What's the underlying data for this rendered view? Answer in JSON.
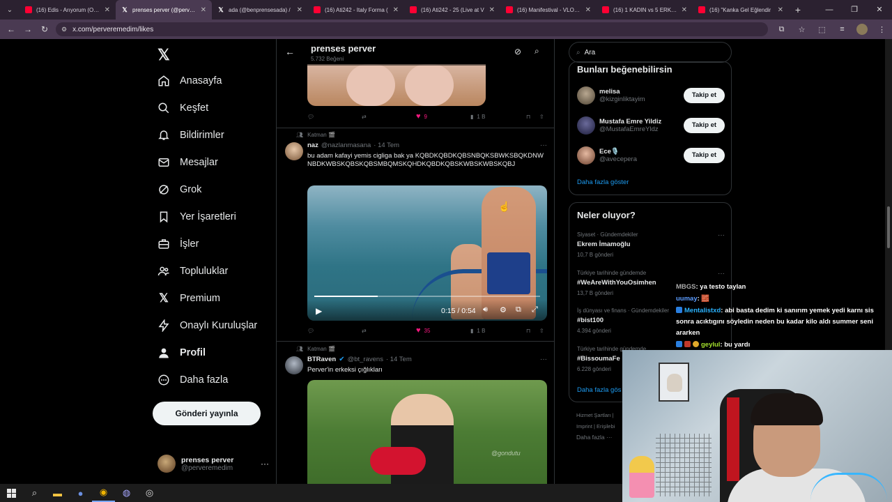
{
  "browser": {
    "tabs": [
      {
        "title": "(16) Edis - Arıyorum (Offic",
        "favicon": "yt",
        "active": false
      },
      {
        "title": "prenses perver (@pervere",
        "favicon": "x",
        "active": true
      },
      {
        "title": "ada (@benprensesada) / ",
        "favicon": "x",
        "active": false
      },
      {
        "title": "(16) Ati242 - Italy Forma (",
        "favicon": "yt",
        "active": false
      },
      {
        "title": "(16) Ati242 - 25 (Live at V",
        "favicon": "yt",
        "active": false
      },
      {
        "title": "(16) Manifestival - VLOG |",
        "favicon": "yt",
        "active": false
      },
      {
        "title": "(16) 1 KADIN vs 5 ERKEK |",
        "favicon": "yt",
        "active": false
      },
      {
        "title": "(16) \"Kanka Gel Eğlendir",
        "favicon": "yt",
        "active": false
      }
    ],
    "url": "x.com/perveremedim/likes"
  },
  "nav": {
    "items": [
      {
        "label": "Anasayfa",
        "icon": "home-icon"
      },
      {
        "label": "Keşfet",
        "icon": "search-icon"
      },
      {
        "label": "Bildirimler",
        "icon": "bell-icon"
      },
      {
        "label": "Mesajlar",
        "icon": "mail-icon"
      },
      {
        "label": "Grok",
        "icon": "grok-icon"
      },
      {
        "label": "Yer İşaretleri",
        "icon": "bookmark-icon"
      },
      {
        "label": "İşler",
        "icon": "briefcase-icon"
      },
      {
        "label": "Topluluklar",
        "icon": "people-icon"
      },
      {
        "label": "Premium",
        "icon": "x-icon"
      },
      {
        "label": "Onaylı Kuruluşlar",
        "icon": "lightning-icon"
      },
      {
        "label": "Profil",
        "icon": "person-icon"
      },
      {
        "label": "Daha fazla",
        "icon": "more-circle-icon"
      }
    ],
    "post_button": "Gönderi yayınla",
    "account": {
      "name": "prenses perver",
      "handle": "@perveremedim"
    }
  },
  "header": {
    "title": "prenses perver",
    "subtitle": "5.732 Beğeni"
  },
  "tweets": [
    {
      "likes": "9",
      "views": "1 B"
    },
    {
      "social_context": "Katman 🎬",
      "name": "naz",
      "handle": "@nazlanmasana",
      "time": "· 14 Tem",
      "text": "bu adam kafayi yemis cigliga bak ya KQBDKQBDKQBSNBQKSBWKSBQKDNWNBDKWBSKQBSKQBSMBQMSKQHDKQBDKQBSKWBSKWBSKQBJ",
      "video": {
        "current": "0:15",
        "duration": "0:54",
        "progress": 0.28
      },
      "likes": "35",
      "views": "1 B"
    },
    {
      "social_context": "Katman 🎬",
      "name": "BTRaven",
      "handle": "@bt_ravens",
      "time": "· 14 Tem",
      "text": "Perver'in erkeksi çığlıkları",
      "watermark": "@gondutu"
    }
  ],
  "search": {
    "placeholder": "Ara"
  },
  "suggestions": {
    "title": "Bunları beğenebilirsin",
    "users": [
      {
        "name": "melisa",
        "handle": "@kizginliktayim",
        "follow": "Takip et"
      },
      {
        "name": "Mustafa Emre Yildiz",
        "handle": "@MustafaEmreYldz",
        "follow": "Takip et"
      },
      {
        "name": "Ece🎙️",
        "handle": "@avecepera",
        "follow": "Takip et"
      }
    ],
    "show_more": "Daha fazla göster"
  },
  "trends": {
    "title": "Neler oluyor?",
    "items": [
      {
        "context": "Siyaset · Gündemdekiler",
        "topic": "Ekrem İmamoğlu",
        "count": "10,7 B gönderi"
      },
      {
        "context": "Türkiye tarihinde gündemde",
        "topic": "#WeAreWithYouOsimhen",
        "count": "13,7 B gönderi"
      },
      {
        "context": "İş dünyası ve finans · Gündemdekiler",
        "topic": "#bist100",
        "count": "4.394 gönderi"
      },
      {
        "context": "Türkiye tarihinde gündemde",
        "topic": "#BissoumaFe",
        "count": "6.228 gönderi"
      }
    ],
    "show_more": "Daha fazla gös"
  },
  "footer": {
    "line1": "Hizmet Şartları  |",
    "line2": "Imprint  |  Erişilebi",
    "line3": "Daha fazla ···"
  },
  "chat": [
    {
      "user": "MBGS",
      "msg": ": ya testo taylan"
    },
    {
      "user": "uumay",
      "msg": ": 🧱"
    },
    {
      "user": "Mentalistxd",
      "msg": ": abi basta dedim ki sanırım yemek yedi karnı sis sonra acıktıgını söyledin neden bu kadar kilo aldı summer seni ararken"
    },
    {
      "user": "geylul",
      "msg": ": bu yardı"
    }
  ],
  "colors": {
    "accent": "#1d9bf0",
    "like": "#f91880",
    "bg": "#000000",
    "border": "#2f3336",
    "muted": "#71767b"
  }
}
